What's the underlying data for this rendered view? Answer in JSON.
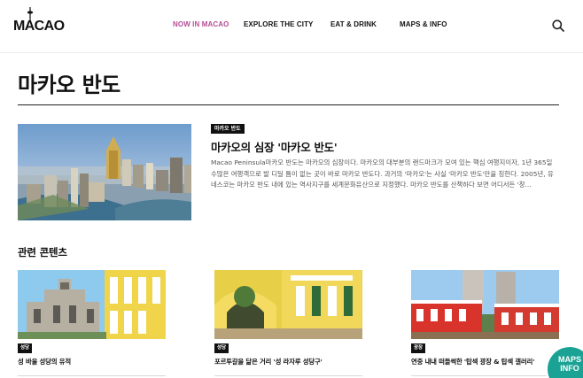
{
  "header": {
    "logo_text": "MACAO",
    "nav": [
      "NOW IN MACAO",
      "EXPLORE THE CITY",
      "EAT & DRINK",
      "MAPS & INFO"
    ],
    "search_icon": "search-icon"
  },
  "page": {
    "title": "마카오 반도"
  },
  "feature": {
    "badge": "마카오 반도",
    "title": "마카오의 심장 '마카오 반도'",
    "description": "Macao Peninsula마카오 반도는 마카오의 심장이다. 마카오의 대부분의 랜드마크가 모여 있는 핵심 여행지이자, 1년 365일 수많은 여행객으로 발 디딜 틈이 없는 곳이 바로 마카오 반도다. 과거의 '마카오'는 사실 '마카오 반도'만을 칭한다. 2005년, 유네스코는 마카오 반도 내에 있는 역사지구를 세계문화유산으로 지정했다. 마카오 반도를 산책하다 보면 어디서든 '창..."
  },
  "related": {
    "heading": "관련 콘텐츠",
    "cards": [
      {
        "badge": "성당",
        "title": "성 바울 성당의 유적"
      },
      {
        "badge": "성당",
        "title": "포르투갈을 닮은 거리 '성 라자루 성당구'"
      },
      {
        "badge": "광장",
        "title": "연중 내내 떠들썩한 '탑섹 광장 & 탑섹 갤러리'"
      }
    ]
  },
  "floating": {
    "line1": "MAPS",
    "line2": "INFO"
  },
  "colors": {
    "accent_nav": "#b54d96",
    "fab": "#1aa394",
    "badge_bg": "#111111"
  }
}
